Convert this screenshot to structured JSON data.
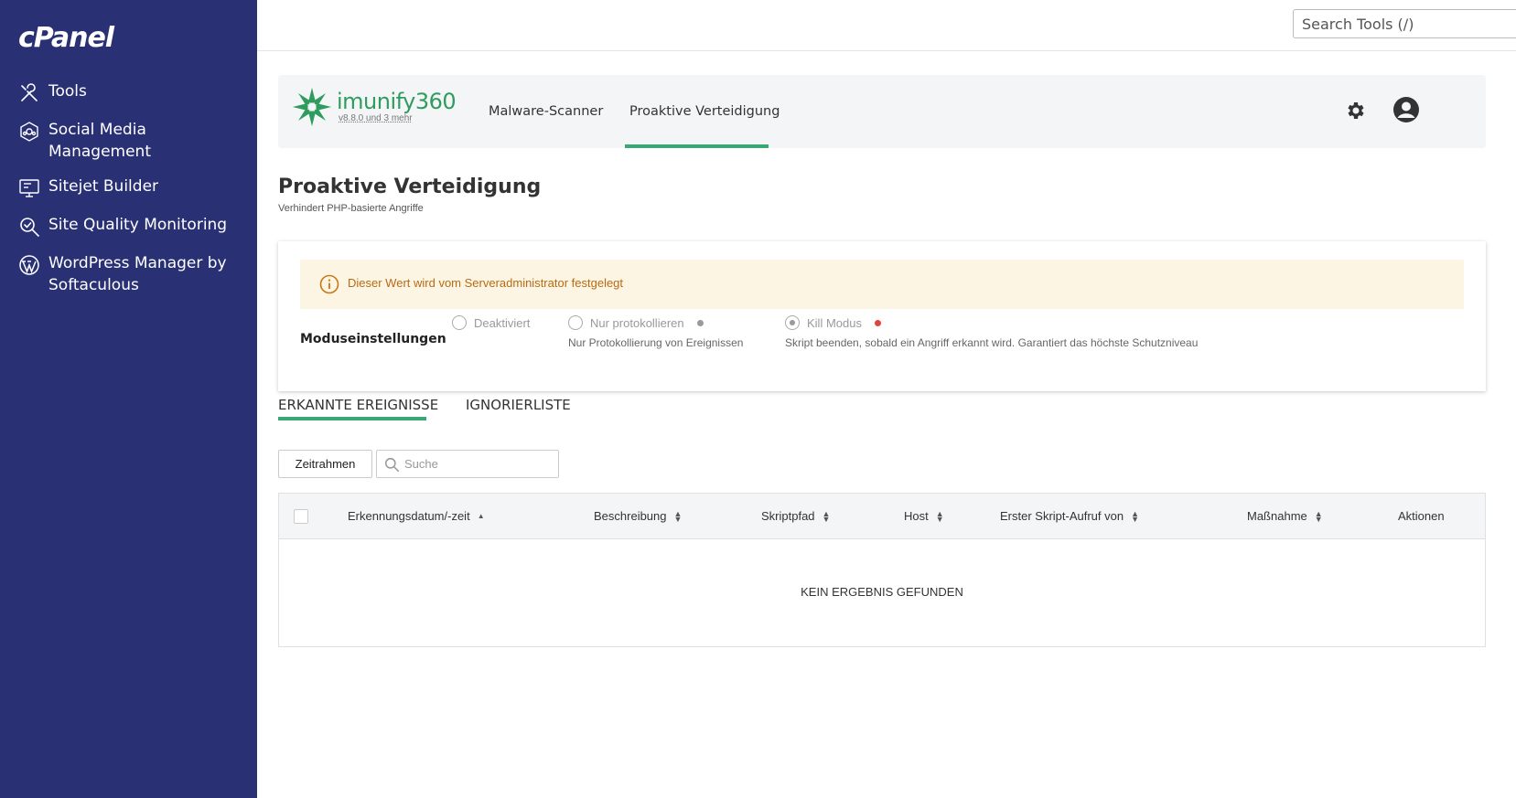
{
  "sidebar": {
    "logo": "cPanel",
    "items": [
      {
        "label": "Tools",
        "icon": "tools-icon"
      },
      {
        "label": "Social Media Management",
        "icon": "social-media-icon"
      },
      {
        "label": "Sitejet Builder",
        "icon": "sitejet-icon"
      },
      {
        "label": "Site Quality Monitoring",
        "icon": "site-quality-icon"
      },
      {
        "label": "WordPress Manager by Softaculous",
        "icon": "wordpress-icon"
      }
    ]
  },
  "topbar": {
    "search_placeholder": "Search Tools (/)"
  },
  "imunify": {
    "brand_name": "imunify360",
    "version": "v8.8.0 und 3 mehr",
    "tabs": [
      {
        "label": "Malware-Scanner"
      },
      {
        "label": "Proaktive Verteidigung"
      }
    ],
    "accent_color": "#3aa874"
  },
  "page": {
    "title": "Proaktive Verteidigung",
    "subtitle": "Verhindert PHP-basierte Angriffe"
  },
  "mode": {
    "alert": "Dieser Wert wird vom Serveradministrator festgelegt",
    "label": "Moduseinstellungen",
    "options": [
      {
        "label": "Deaktiviert",
        "desc": ""
      },
      {
        "label": "Nur protokollieren",
        "desc": "Nur Protokollierung von Ereignissen",
        "badge_color": "#999999"
      },
      {
        "label": "Kill Modus",
        "desc": "Skript beenden, sobald ein Angriff erkannt wird. Garantiert das höchste Schutzniveau",
        "badge_color": "#e0453d"
      }
    ],
    "selected": "Kill Modus"
  },
  "tabs": {
    "events": "ERKANNTE EREIGNISSE",
    "ignore": "IGNORIERLISTE"
  },
  "filters": {
    "timeframe": "Zeitrahmen",
    "search_placeholder": "Suche"
  },
  "table": {
    "columns": [
      "Erkennungsdatum/-zeit",
      "Beschreibung",
      "Skriptpfad",
      "Host",
      "Erster Skript-Aufruf von",
      "Maßnahme",
      "Aktionen"
    ],
    "empty": "KEIN ERGEBNIS GEFUNDEN"
  }
}
